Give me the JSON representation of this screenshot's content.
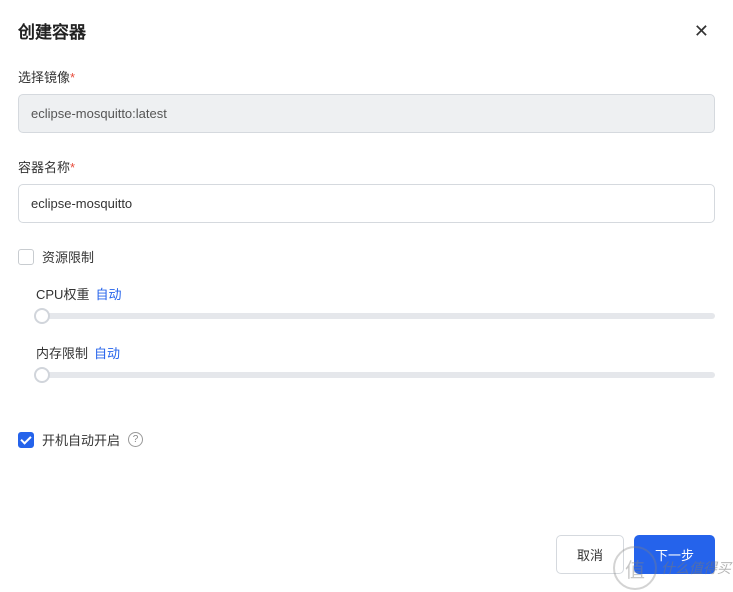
{
  "modal": {
    "title": "创建容器"
  },
  "form": {
    "image": {
      "label": "选择镜像",
      "value": "eclipse-mosquitto:latest"
    },
    "name": {
      "label": "容器名称",
      "value": "eclipse-mosquitto"
    },
    "resource_limit": {
      "label": "资源限制",
      "checked": false
    },
    "cpu": {
      "label": "CPU权重",
      "value": "自动"
    },
    "memory": {
      "label": "内存限制",
      "value": "自动"
    },
    "autostart": {
      "label": "开机自动开启",
      "checked": true
    }
  },
  "footer": {
    "cancel": "取消",
    "next": "下一步"
  },
  "watermark": {
    "seal": "值",
    "text": "什么值得买"
  }
}
